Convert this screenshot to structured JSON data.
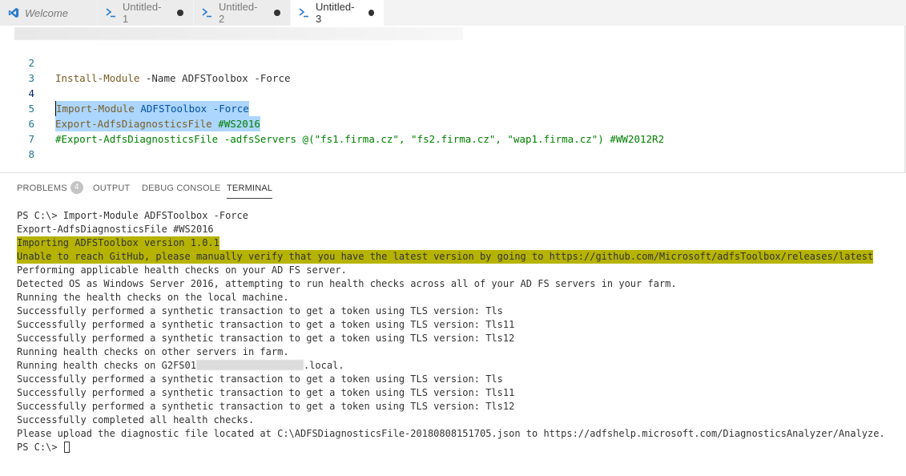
{
  "tabs": [
    {
      "label": "Welcome",
      "icon": "vscode-logo-icon",
      "dirty": false,
      "active": false
    },
    {
      "label": "Untitled-1",
      "icon": "powershell-icon",
      "dirty": true,
      "active": false
    },
    {
      "label": "Untitled-2",
      "icon": "powershell-icon",
      "dirty": true,
      "active": false
    },
    {
      "label": "Untitled-3",
      "icon": "powershell-icon",
      "dirty": true,
      "active": true
    }
  ],
  "editor": {
    "lines": [
      {
        "num": "2",
        "cmd": "Install-Module",
        "rest": " -Name ADFSToolbox -Force"
      },
      {
        "num": "3"
      },
      {
        "num": "4",
        "cmd": "Import-Module",
        "param": " ADFSToolbox -Force"
      },
      {
        "num": "5",
        "cmd": "Export-AdfsDiagnosticsFile",
        "comment": " #WS2016"
      },
      {
        "num": "6",
        "comment": "#Export-AdfsDiagnosticsFile -adfsServers @(\"fs1.firma.cz\", \"fs2.firma.cz\", \"wap1.firma.cz\") #WW2012R2"
      },
      {
        "num": "7"
      },
      {
        "num": "8"
      }
    ]
  },
  "panel": {
    "tabs": {
      "problems": "PROBLEMS",
      "problems_count": "4",
      "output": "OUTPUT",
      "debug": "DEBUG CONSOLE",
      "terminal": "TERMINAL"
    }
  },
  "terminal": {
    "lines": [
      "PS C:\\> Import-Module ADFSToolbox -Force",
      "Export-AdfsDiagnosticsFile #WS2016",
      "Importing ADFSToolbox version 1.0.1",
      "Unable to reach GitHub, please manually verify that you have the latest version by going to https://github.com/Microsoft/adfsToolbox/releases/latest",
      "Performing applicable health checks on your AD FS server.",
      "Detected OS as Windows Server 2016, attempting to run health checks across all of your AD FS servers in your farm.",
      "Running the health checks on the local machine.",
      "Successfully performed a synthetic transaction to get a token using TLS version: Tls",
      "Successfully performed a synthetic transaction to get a token using TLS version: Tls11",
      "Successfully performed a synthetic transaction to get a token using TLS version: Tls12",
      "Running health checks on other servers in farm.",
      "Running health checks on G2FS01",
      ".local.",
      "Successfully performed a synthetic transaction to get a token using TLS version: Tls",
      "Successfully performed a synthetic transaction to get a token using TLS version: Tls11",
      "Successfully performed a synthetic transaction to get a token using TLS version: Tls12",
      "Successfully completed all health checks.",
      "Please upload the diagnostic file located at C:\\ADFSDiagnosticsFile-20180808151705.json to https://adfshelp.microsoft.com/DiagnosticsAnalyzer/Analyze.",
      "PS C:\\> "
    ]
  },
  "colors": {
    "highlight": "#b5b300",
    "selection": "#add6ff",
    "line_number": "#237893",
    "comment": "#008000"
  }
}
